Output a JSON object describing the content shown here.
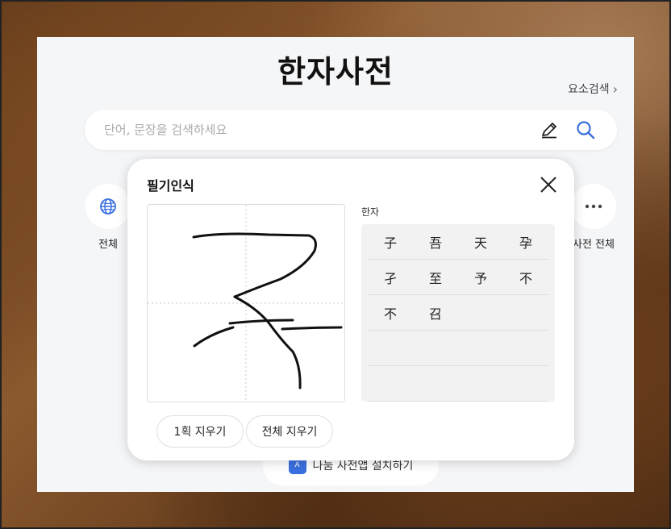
{
  "page": {
    "title": "한자사전",
    "radical_search": "요소검색",
    "search_placeholder": "단어, 문장을 검색하세요"
  },
  "categories": {
    "left_label": "전체",
    "right_label": "사전 전체"
  },
  "install_button": "나눔 사전앱 설치하기",
  "handwriting": {
    "title": "필기인식",
    "results_label": "한자",
    "results": [
      [
        "子",
        "吾",
        "天",
        "孕"
      ],
      [
        "孑",
        "至",
        "予",
        "不"
      ],
      [
        "不",
        "召"
      ]
    ],
    "undo_stroke": "1획 지우기",
    "clear_all": "전체 지우기"
  },
  "colors": {
    "accent": "#3b6fe0",
    "page_bg": "#f5f6f8"
  },
  "icons": {
    "radical_link": "chevron-right-icon",
    "pen": "pen-icon",
    "search": "search-icon",
    "globe": "globe-icon",
    "more": "more-icon",
    "close": "close-icon",
    "app": "dictionary-app-icon"
  }
}
